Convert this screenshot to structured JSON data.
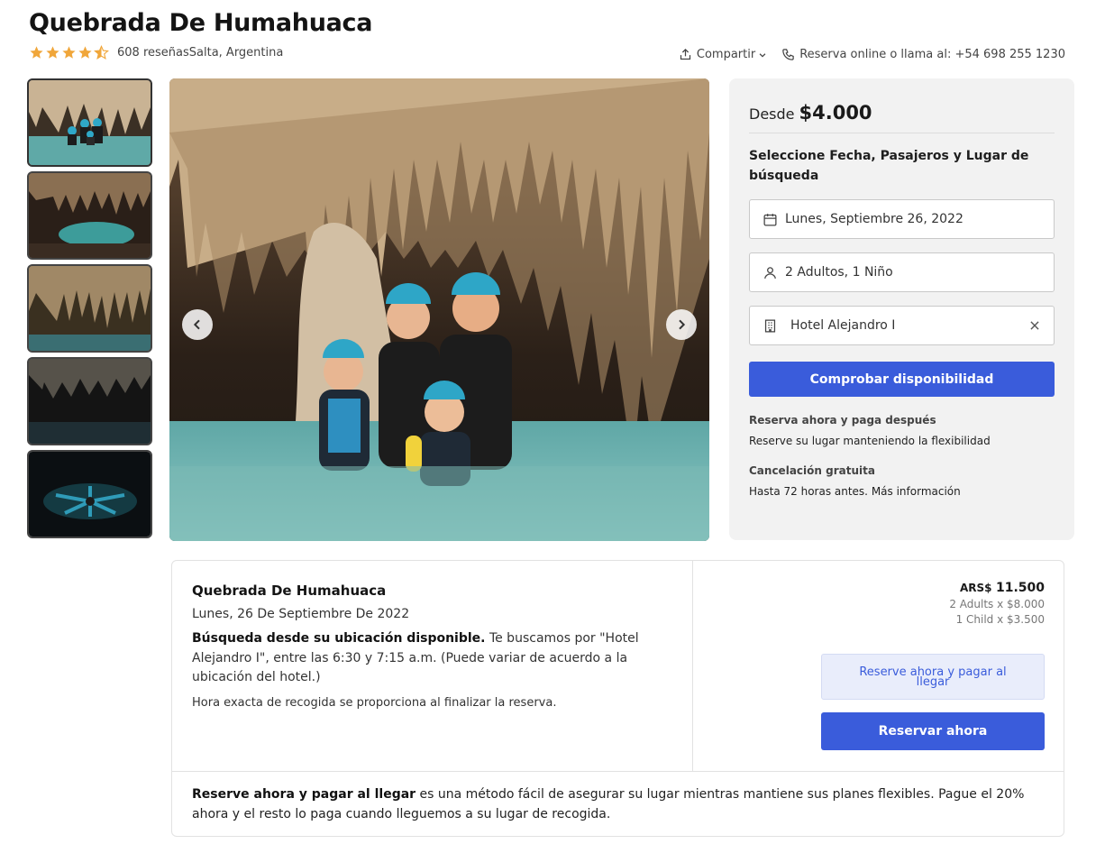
{
  "page": {
    "title": "Quebrada De Humahuaca",
    "rating": 4.5,
    "reviews": "608 reseñas",
    "location": "Salta, Argentina",
    "share_label": "Compartir",
    "contact": "Reserva online o llama al: +54 698 255 1230"
  },
  "gallery": {
    "thumbnails": [
      "thumb-1",
      "thumb-2",
      "thumb-3",
      "thumb-4",
      "thumb-5"
    ],
    "active_index": 0
  },
  "booking": {
    "from_label": "Desde",
    "price": "$4.000",
    "heading": "Seleccione Fecha, Pasajeros y Lugar de búsqueda",
    "date_value": "Lunes, Septiembre 26, 2022",
    "passengers_value": "2 Adultos, 1 Niño",
    "hotel_value": "Hotel Alejandro I",
    "check_button": "Comprobar disponibilidad",
    "info": [
      {
        "heading": "Reserva ahora y paga después",
        "text": "Reserve su lugar manteniendo la flexibilidad"
      },
      {
        "heading": "Cancelación gratuita",
        "text": "Hasta 72 horas antes. Más información"
      }
    ]
  },
  "summary": {
    "title": "Quebrada De Humahuaca",
    "date": "Lunes, 26 De Septiembre De 2022",
    "pickup_bold": "Búsqueda desde su ubicación disponible.",
    "pickup_text": " Te buscamos por \"Hotel Alejandro I\", entre las 6:30 y 7:15 a.m. (Puede variar de acuerdo a la ubicación del hotel.)",
    "note": "Hora exacta de recogida se proporciona al finalizar la reserva.",
    "currency": "ARS$",
    "total": "11.500",
    "lines": [
      "2 Adults x $8.000",
      "1 Child x $3.500"
    ],
    "pay_later_button": "Reserve ahora y pagar al llegar",
    "book_button": "Reservar ahora",
    "footer_bold": "Reserve ahora y pagar al llegar",
    "footer_text": " es una método fácil de asegurar su lugar mientras mantiene sus planes flexibles. Pague el 20% ahora y el resto lo paga cuando lleguemos a su lugar de recogida."
  },
  "colors": {
    "accent": "#3a5cdb",
    "star": "#f0a63a",
    "panel_bg": "#f2f2f2"
  }
}
